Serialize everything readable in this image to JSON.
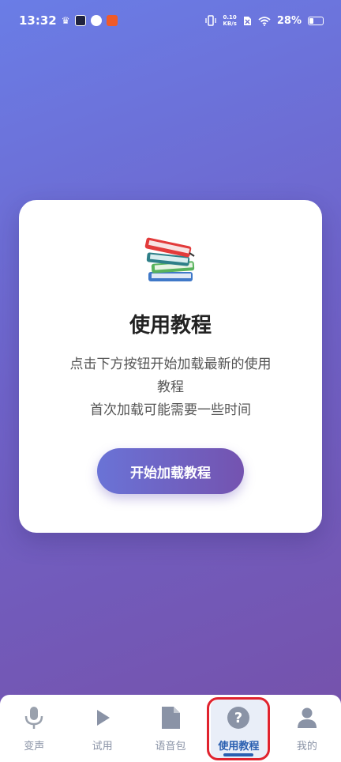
{
  "status_bar": {
    "time": "13:32",
    "net_speed_value": "0.10",
    "net_speed_unit": "KB/s",
    "battery": "28%"
  },
  "card": {
    "icon": "books-icon",
    "title": "使用教程",
    "desc_line1": "点击下方按钮开始加载最新的使用",
    "desc_line2": "教程",
    "desc_line3": "首次加载可能需要一些时间",
    "button_label": "开始加载教程"
  },
  "nav": {
    "items": [
      {
        "label": "变声",
        "icon": "microphone-icon"
      },
      {
        "label": "试用",
        "icon": "play-icon"
      },
      {
        "label": "语音包",
        "icon": "file-icon"
      },
      {
        "label": "使用教程",
        "icon": "help-icon",
        "active": true
      },
      {
        "label": "我的",
        "icon": "person-icon"
      }
    ]
  },
  "colors": {
    "accent": "#2a5fb0",
    "inactive": "#8a93a6",
    "highlight": "#e0232e"
  }
}
